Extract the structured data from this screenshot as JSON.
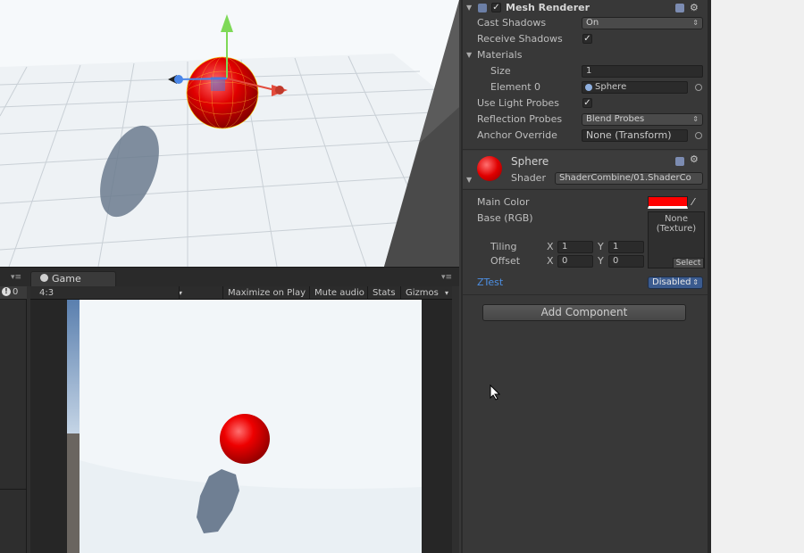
{
  "mesh_renderer": {
    "title": "Mesh Renderer",
    "cast_shadows_label": "Cast Shadows",
    "cast_shadows_value": "On",
    "receive_shadows_label": "Receive Shadows",
    "materials_label": "Materials",
    "size_label": "Size",
    "size_value": "1",
    "element0_label": "Element 0",
    "element0_value": "Sphere",
    "light_probes_label": "Use Light Probes",
    "reflection_probes_label": "Reflection Probes",
    "reflection_probes_value": "Blend Probes",
    "anchor_override_label": "Anchor Override",
    "anchor_override_value": "None (Transform)"
  },
  "material": {
    "name": "Sphere",
    "shader_label": "Shader",
    "shader_value": "ShaderCombine/01.ShaderCo",
    "main_color_label": "Main Color",
    "main_color": "#ff0000",
    "base_label": "Base (RGB)",
    "texture_none": "None",
    "texture_type": "(Texture)",
    "select_label": "Select",
    "tiling_label": "Tiling",
    "offset_label": "Offset",
    "tiling_x": "1",
    "tiling_y": "1",
    "offset_x": "0",
    "offset_y": "0",
    "x_label": "X",
    "y_label": "Y",
    "ztest_label": "ZTest",
    "ztest_value": "Disabled"
  },
  "add_component_label": "Add Component",
  "game": {
    "tab_label": "Game",
    "aspect": "4:3",
    "maximize_label": "Maximize on Play",
    "mute_label": "Mute audio",
    "stats_label": "Stats",
    "gizmos_label": "Gizmos"
  },
  "left_strip": {
    "console_count": "0"
  },
  "colors": {
    "sphere": "#ff0000",
    "link_blue": "#4d8fe3",
    "accent": "#3b5b8f"
  }
}
